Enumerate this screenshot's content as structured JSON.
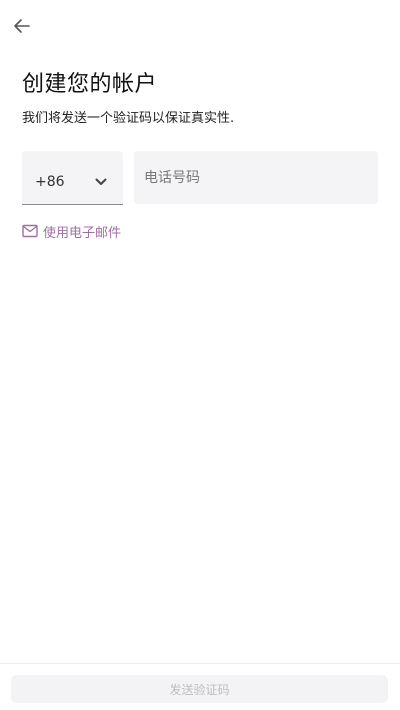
{
  "header": {
    "back_icon": "arrow-left-icon"
  },
  "main": {
    "title": "创建您的帐户",
    "subtitle": "我们将发送一个验证码以保证真实性.",
    "country_code": {
      "value": "+86",
      "icon": "chevron-down-icon"
    },
    "phone": {
      "value": "",
      "placeholder": "电话号码"
    },
    "email_link": {
      "label": "使用电子邮件",
      "icon": "mail-icon",
      "color": "#a06fa5"
    }
  },
  "footer": {
    "send_button_label": "发送验证码",
    "send_button_enabled": false
  }
}
